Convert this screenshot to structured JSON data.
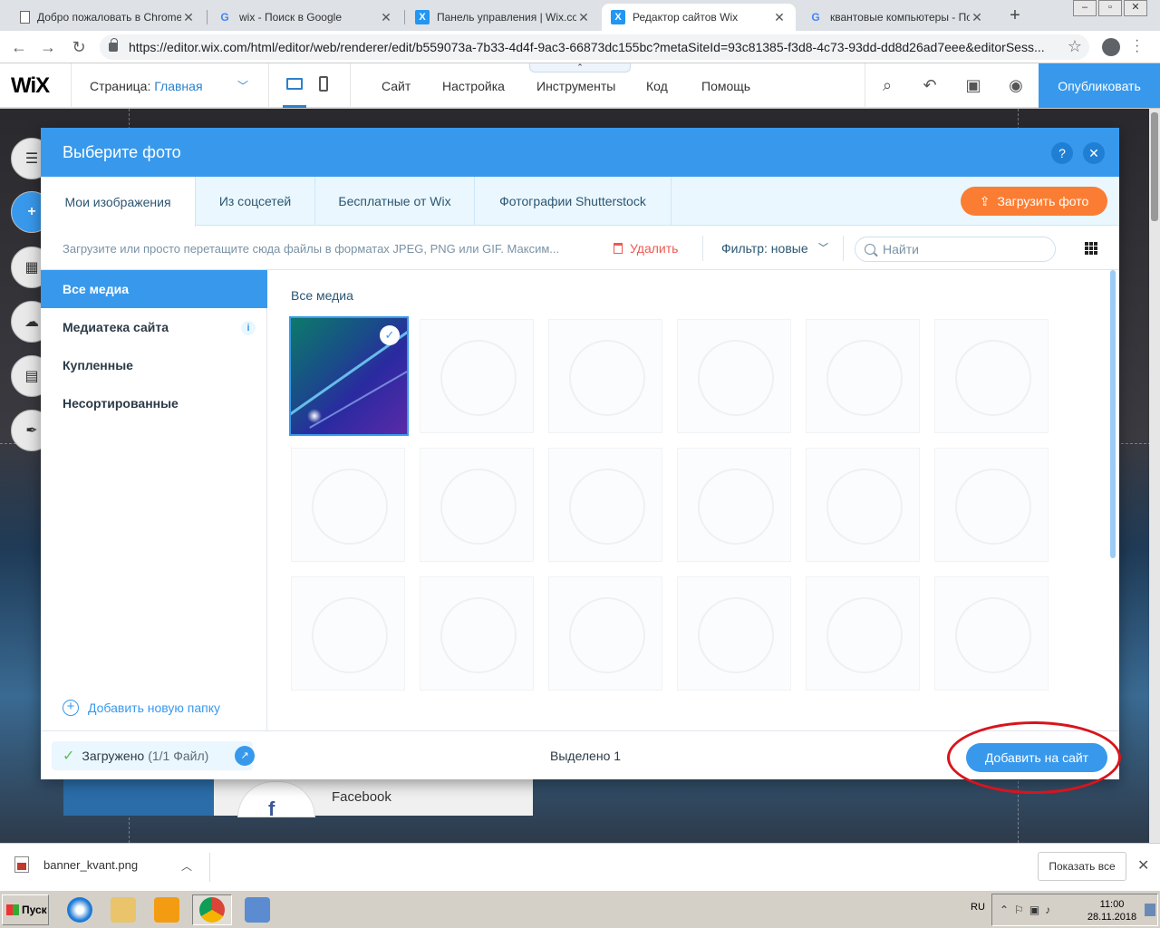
{
  "browser": {
    "tabs": [
      {
        "title": "Добро пожаловать в Chrome!",
        "icon": "document-icon"
      },
      {
        "title": "wix - Поиск в Google",
        "icon": "google-icon"
      },
      {
        "title": "Панель управления | Wix.com",
        "icon": "wix-icon"
      },
      {
        "title": "Редактор сайтов Wix",
        "icon": "wix-icon",
        "active": true
      },
      {
        "title": "квантовые компьютеры - Поиск",
        "icon": "google-icon"
      }
    ],
    "url": "https://editor.wix.com/html/editor/web/renderer/edit/b559073a-7b33-4d4f-9ac3-66873dc155bc?metaSiteId=93c81385-f3d8-4c73-93dd-dd8d26ad7eee&editorSess..."
  },
  "wixbar": {
    "logo": "WiX",
    "page_label": "Страница:",
    "page_value": "Главная",
    "nav": [
      "Сайт",
      "Настройка",
      "Инструменты",
      "Код",
      "Помощь"
    ],
    "publish": "Опубликовать"
  },
  "background": {
    "facebook_label": "Facebook",
    "facebook_letter": "f"
  },
  "modal": {
    "title": "Выберите фото",
    "help": "?",
    "close": "✕",
    "tabs": [
      "Мои изображения",
      "Из соцсетей",
      "Бесплатные от Wix",
      "Фотографии Shutterstock"
    ],
    "upload_button": "Загрузить фото",
    "hint": "Загрузите или просто перетащите сюда файлы в форматах JPEG, PNG или GIF. Максим...",
    "delete": "Удалить",
    "filter": "Фильтр: новые",
    "search_placeholder": "Найти",
    "sidebar": {
      "items": [
        "Все медиа",
        "Медиатека сайта",
        "Купленные",
        "Несортированные"
      ],
      "info": "i",
      "add_folder": "Добавить новую папку"
    },
    "content": {
      "breadcrumb": "Все медиа"
    },
    "footer": {
      "uploaded": "Загружено",
      "uploaded_count": "(1/1 Файл)",
      "selected": "Выделено 1",
      "add_button": "Добавить на сайт"
    }
  },
  "downloads": {
    "file": "banner_kvant.png",
    "show_all": "Показать все"
  },
  "taskbar": {
    "start": "Пуск",
    "lang": "RU",
    "time": "11:00",
    "date": "28.11.2018"
  },
  "colors": {
    "wix_blue": "#3899ec",
    "upload_orange": "#fb7d33",
    "delete_red": "#ee5951",
    "highlight_red": "#d8141d"
  }
}
